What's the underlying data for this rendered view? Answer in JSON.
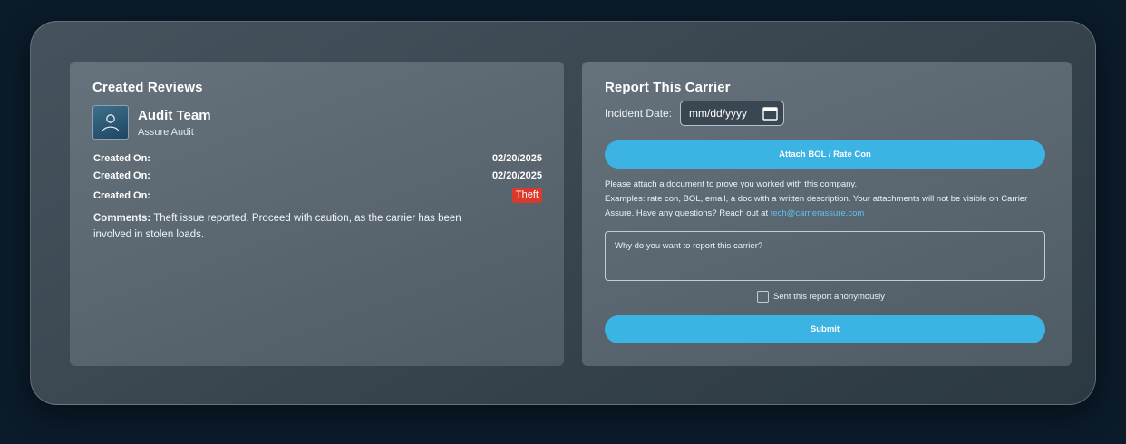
{
  "reviews": {
    "title": "Created Reviews",
    "reviewer_name": "Audit Team",
    "reviewer_org": "Assure Audit",
    "rows": [
      {
        "label": "Created On:",
        "value": "02/20/2025"
      },
      {
        "label": "Created On:",
        "value": "02/20/2025"
      },
      {
        "label": "Created On:",
        "value": "Theft"
      }
    ],
    "comments_label": "Comments:",
    "comments_text": "Theft issue reported. Proceed with caution, as the carrier has been involved in stolen loads.",
    "badge_color": "#d93a2b"
  },
  "report": {
    "title": "Report This Carrier",
    "incident_label": "Incident Date:",
    "date_placeholder": "mm/dd/yyyy",
    "attach_label": "Attach BOL / Rate Con",
    "help_line1": "Please attach a document to prove you worked with this company.",
    "help_line2": "Examples: rate con, BOL, email, a doc with a written description. Your attachments will not be visible on Carrier Assure. Have any questions? Reach out at",
    "help_email": "tech@carrierassure.com",
    "reason_placeholder": "Why do you want to report this carrier?",
    "anonymous_label": "Sent this report anonymously",
    "submit_label": "Submit",
    "accent_color": "#3bb3e3"
  },
  "icons": {
    "avatar": "user-avatar-icon",
    "calendar": "calendar-icon"
  }
}
